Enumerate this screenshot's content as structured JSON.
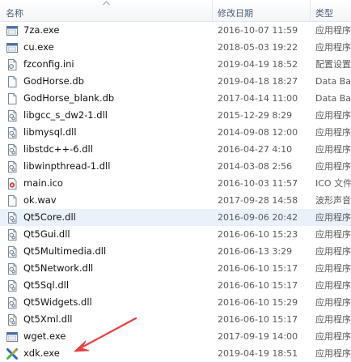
{
  "columns": {
    "name": "名称",
    "date": "修改日期",
    "type": "类型"
  },
  "files": [
    {
      "name": "7za.exe",
      "date": "2016-10-07 11:59",
      "type": "应用程序",
      "icon": "exe-window-icon"
    },
    {
      "name": "cu.exe",
      "date": "2018-05-03 19:22",
      "type": "应用程序",
      "icon": "exe-window-icon"
    },
    {
      "name": "fzconfig.ini",
      "date": "2019-04-19 18:52",
      "type": "配置设置",
      "icon": "ini-config-icon"
    },
    {
      "name": "GodHorse.db",
      "date": "2019-04-18 18:27",
      "type": "Data Base",
      "icon": "file-icon"
    },
    {
      "name": "GodHorse_blank.db",
      "date": "2017-04-14 11:00",
      "type": "Data Base",
      "icon": "file-icon"
    },
    {
      "name": "libgcc_s_dw2-1.dll",
      "date": "2015-12-29 8:29",
      "type": "应用程序扩展",
      "icon": "dll-icon"
    },
    {
      "name": "libmysql.dll",
      "date": "2014-09-08 12:00",
      "type": "应用程序扩展",
      "icon": "dll-icon"
    },
    {
      "name": "libstdc++-6.dll",
      "date": "2016-04-27 4:10",
      "type": "应用程序扩展",
      "icon": "dll-icon"
    },
    {
      "name": "libwinpthread-1.dll",
      "date": "2014-03-08 2:56",
      "type": "应用程序扩展",
      "icon": "dll-icon"
    },
    {
      "name": "main.ico",
      "date": "2016-10-03 11:57",
      "type": "ICO 文件",
      "icon": "ico-image-icon"
    },
    {
      "name": "ok.wav",
      "date": "2017-09-28 14:58",
      "type": "波形声音",
      "icon": "file-icon"
    },
    {
      "name": "Qt5Core.dll",
      "date": "2016-09-06 20:42",
      "type": "应用程序扩展",
      "icon": "dll-icon",
      "highlighted": true
    },
    {
      "name": "Qt5Gui.dll",
      "date": "2016-06-10 15:23",
      "type": "应用程序扩展",
      "icon": "dll-icon"
    },
    {
      "name": "Qt5Multimedia.dll",
      "date": "2016-06-13 3:29",
      "type": "应用程序扩展",
      "icon": "dll-icon"
    },
    {
      "name": "Qt5Network.dll",
      "date": "2016-06-10 15:17",
      "type": "应用程序扩展",
      "icon": "dll-icon"
    },
    {
      "name": "Qt5Sql.dll",
      "date": "2016-06-10 15:17",
      "type": "应用程序扩展",
      "icon": "dll-icon"
    },
    {
      "name": "Qt5Widgets.dll",
      "date": "2016-06-10 15:29",
      "type": "应用程序扩展",
      "icon": "dll-icon"
    },
    {
      "name": "Qt5Xml.dll",
      "date": "2016-06-10 15:17",
      "type": "应用程序扩展",
      "icon": "dll-icon"
    },
    {
      "name": "wget.exe",
      "date": "2017-09-19 14:00",
      "type": "应用程序",
      "icon": "exe-window-icon"
    },
    {
      "name": "xdk.exe",
      "date": "2019-04-19 18:51",
      "type": "应用程序",
      "icon": "xdk-app-icon"
    }
  ],
  "annotation": {
    "arrow_color": "#e8413f",
    "icon": "red-arrow-icon"
  }
}
